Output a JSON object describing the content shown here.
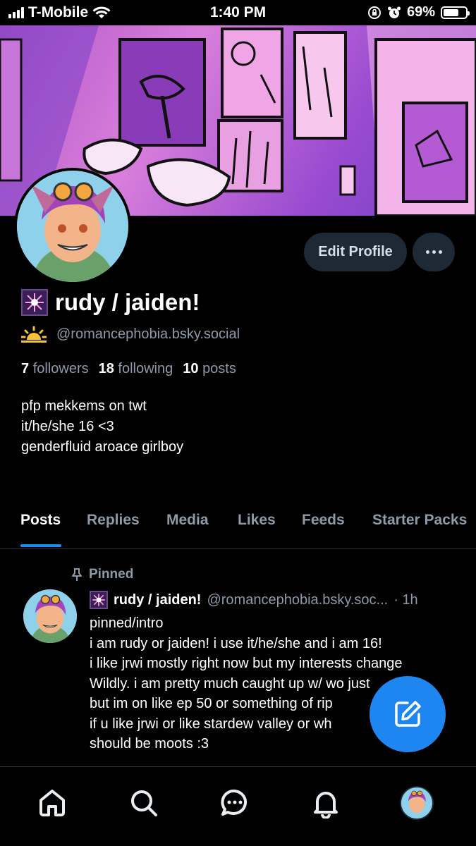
{
  "status_bar": {
    "carrier": "T-Mobile",
    "time": "1:40 PM",
    "battery": "69%",
    "battery_level": 0.69
  },
  "profile": {
    "display_name": "rudy / jaiden!",
    "handle": "@romancephobia.bsky.social",
    "edit_button": "Edit Profile",
    "stats": {
      "followers_count": "7",
      "followers_label": "followers",
      "following_count": "18",
      "following_label": "following",
      "posts_count": "10",
      "posts_label": "posts"
    },
    "bio_lines": [
      "pfp mekkems on twt",
      "it/he/she 16 <3",
      "genderfluid aroace girlboy"
    ]
  },
  "tabs": [
    "Posts",
    "Replies",
    "Media",
    "Likes",
    "Feeds",
    "Starter Packs"
  ],
  "active_tab": "Posts",
  "post": {
    "pinned_label": "Pinned",
    "author_name": "rudy / jaiden!",
    "author_handle": "@romancephobia.bsky.soc...",
    "time": "· 1h",
    "lines": [
      "pinned/intro",
      "i am rudy or jaiden! i use it/he/she and i am 16!",
      "i like jrwi mostly right now but my interests change",
      "Wildly. i am pretty much caught up w/ wo      just",
      "but im on like ep 50 or something of rip",
      "if u like jrwi or like stardew valley or wh",
      "should be moots :3"
    ]
  },
  "colors": {
    "accent": "#1d86f0",
    "button_bg": "#1e2936",
    "muted_text": "#8d9aa8",
    "background": "#000000"
  },
  "nav_icons": [
    "home-icon",
    "search-icon",
    "chat-icon",
    "bell-icon",
    "profile-avatar"
  ]
}
